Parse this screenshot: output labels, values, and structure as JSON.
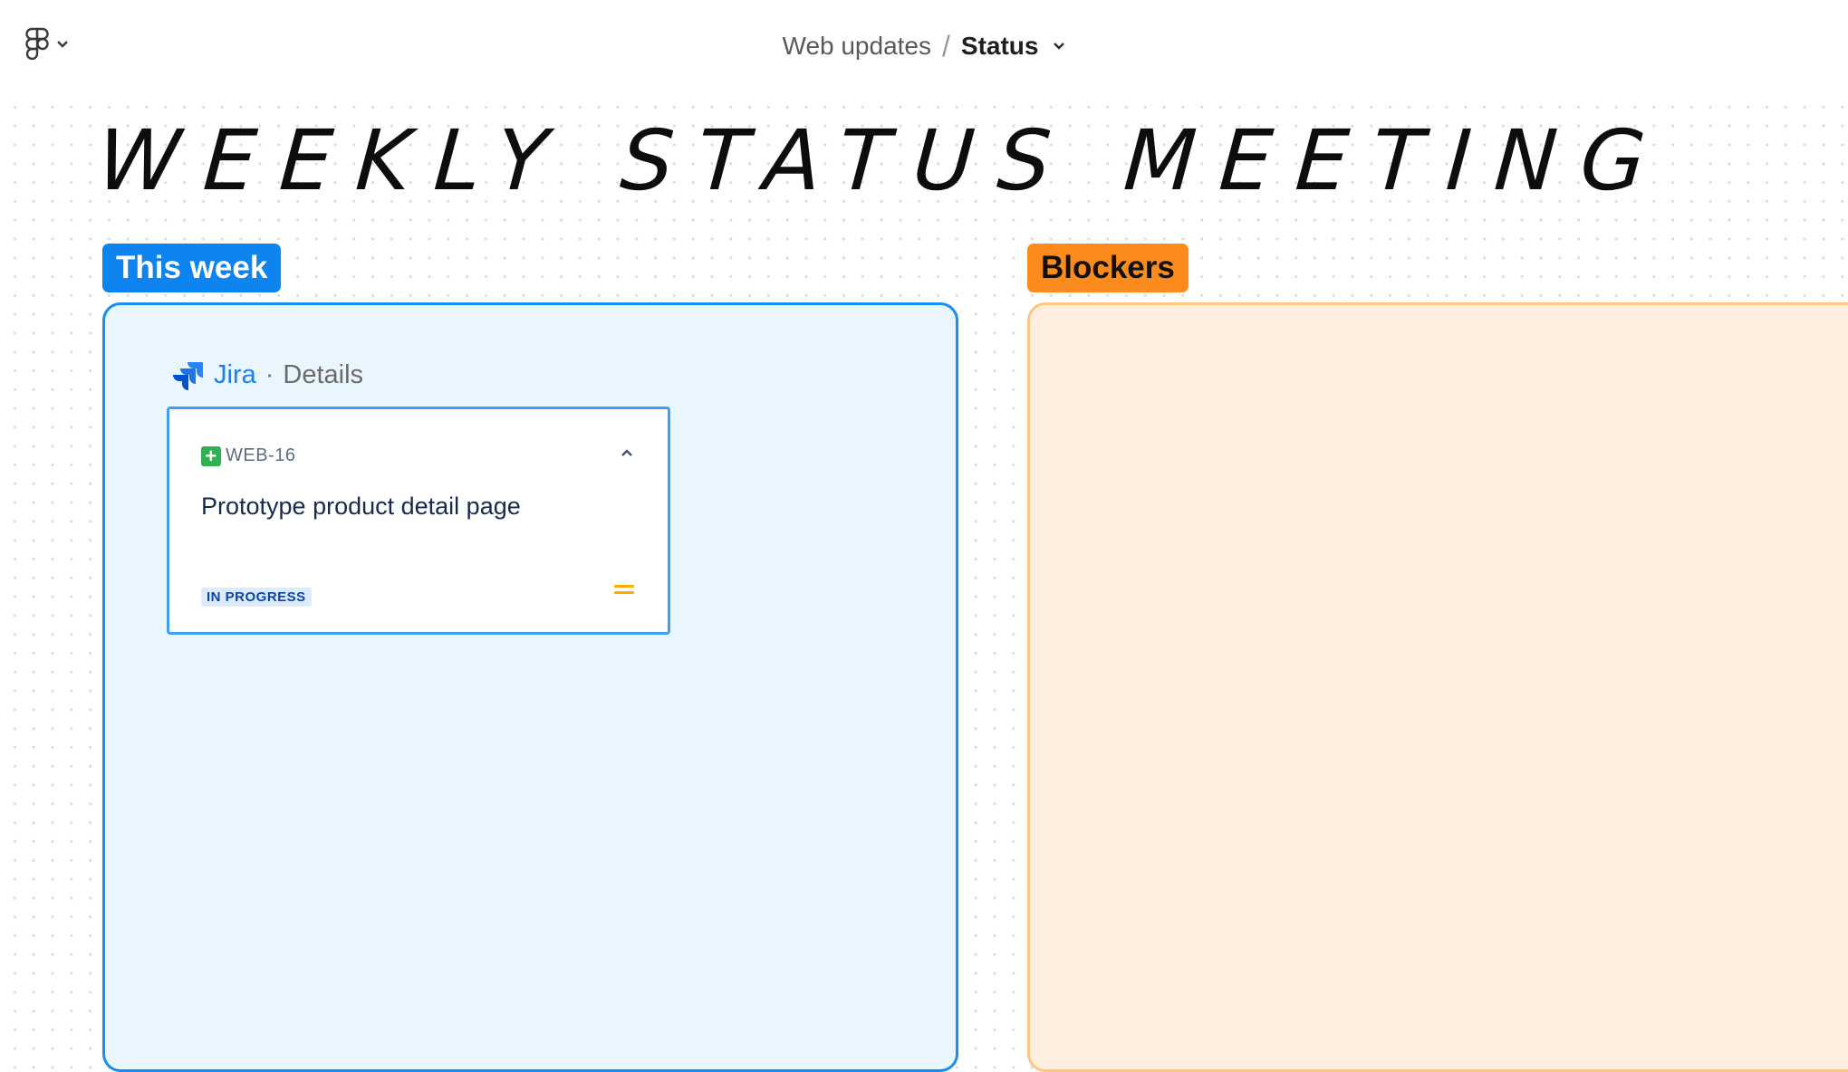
{
  "header": {
    "app_menu": {
      "icon": "figma-logo-icon"
    },
    "breadcrumb": {
      "parent": "Web updates",
      "separator": "/",
      "current": "Status"
    }
  },
  "board": {
    "title": "WEEKLY STATUS MEETING",
    "sections": [
      {
        "label": "This week",
        "color": "#0d84f0",
        "panel_fill": "#e9f6fd"
      },
      {
        "label": "Blockers",
        "color": "#fb8b1c",
        "panel_fill": "#feefdf"
      }
    ]
  },
  "jira_widget": {
    "app_name": "Jira",
    "separator": "·",
    "view": "Details",
    "issue": {
      "type_icon": "story-icon",
      "key": "WEB-16",
      "summary": "Prototype product detail page",
      "status": "IN PROGRESS",
      "priority_icon": "priority-medium-icon",
      "priority_color": "#ffab00"
    }
  }
}
